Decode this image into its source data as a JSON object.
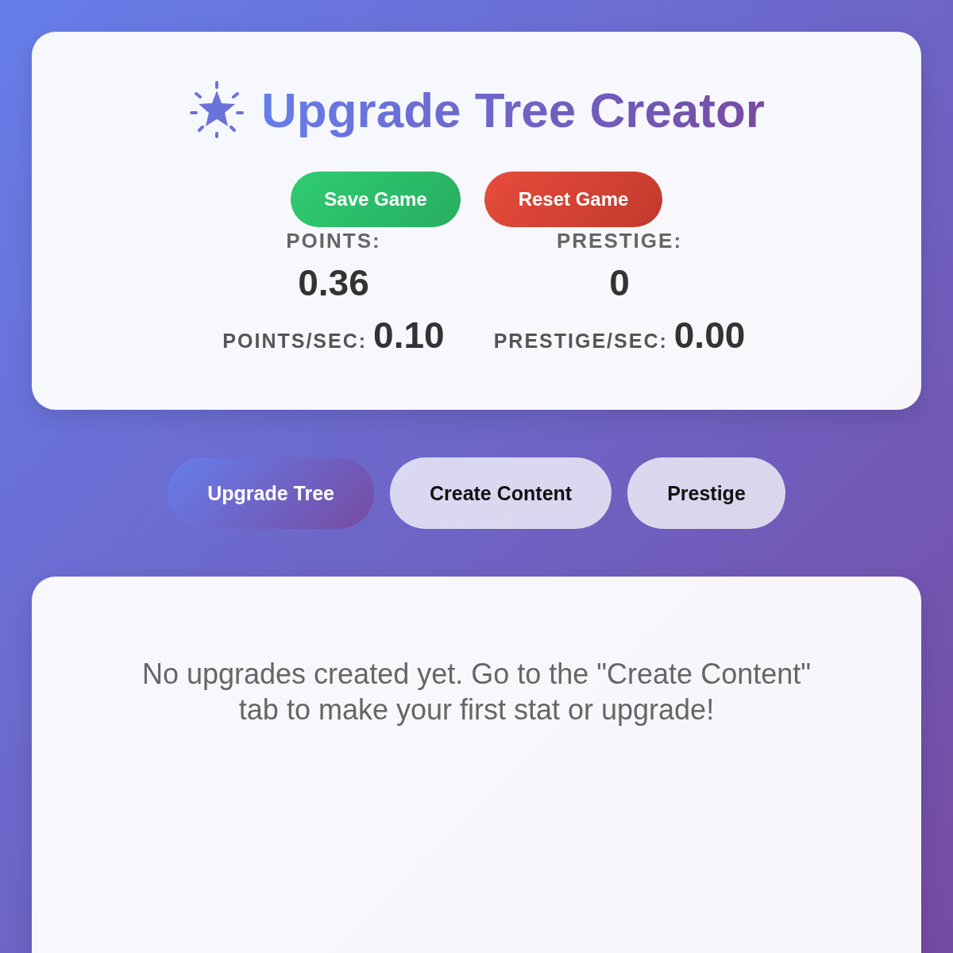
{
  "header": {
    "title": "Upgrade Tree Creator",
    "buttons": [
      {
        "label": "Save Game",
        "kind": "save"
      },
      {
        "label": "Reset Game",
        "kind": "reset"
      }
    ],
    "stats": [
      {
        "label": "POINTS:",
        "value": "0.36",
        "rate_label": "POINTS/SEC:",
        "rate_value": "0.10"
      },
      {
        "label": "PRESTIGE:",
        "value": "0",
        "rate_label": "PRESTIGE/SEC:",
        "rate_value": "0.00"
      }
    ]
  },
  "tabs": [
    {
      "label": "Upgrade Tree",
      "selected": true
    },
    {
      "label": "Create Content",
      "selected": false
    },
    {
      "label": "Prestige",
      "selected": false
    }
  ],
  "content": {
    "empty_message": "No upgrades created yet. Go to the \"Create Content\" tab to make your first stat or upgrade!"
  }
}
